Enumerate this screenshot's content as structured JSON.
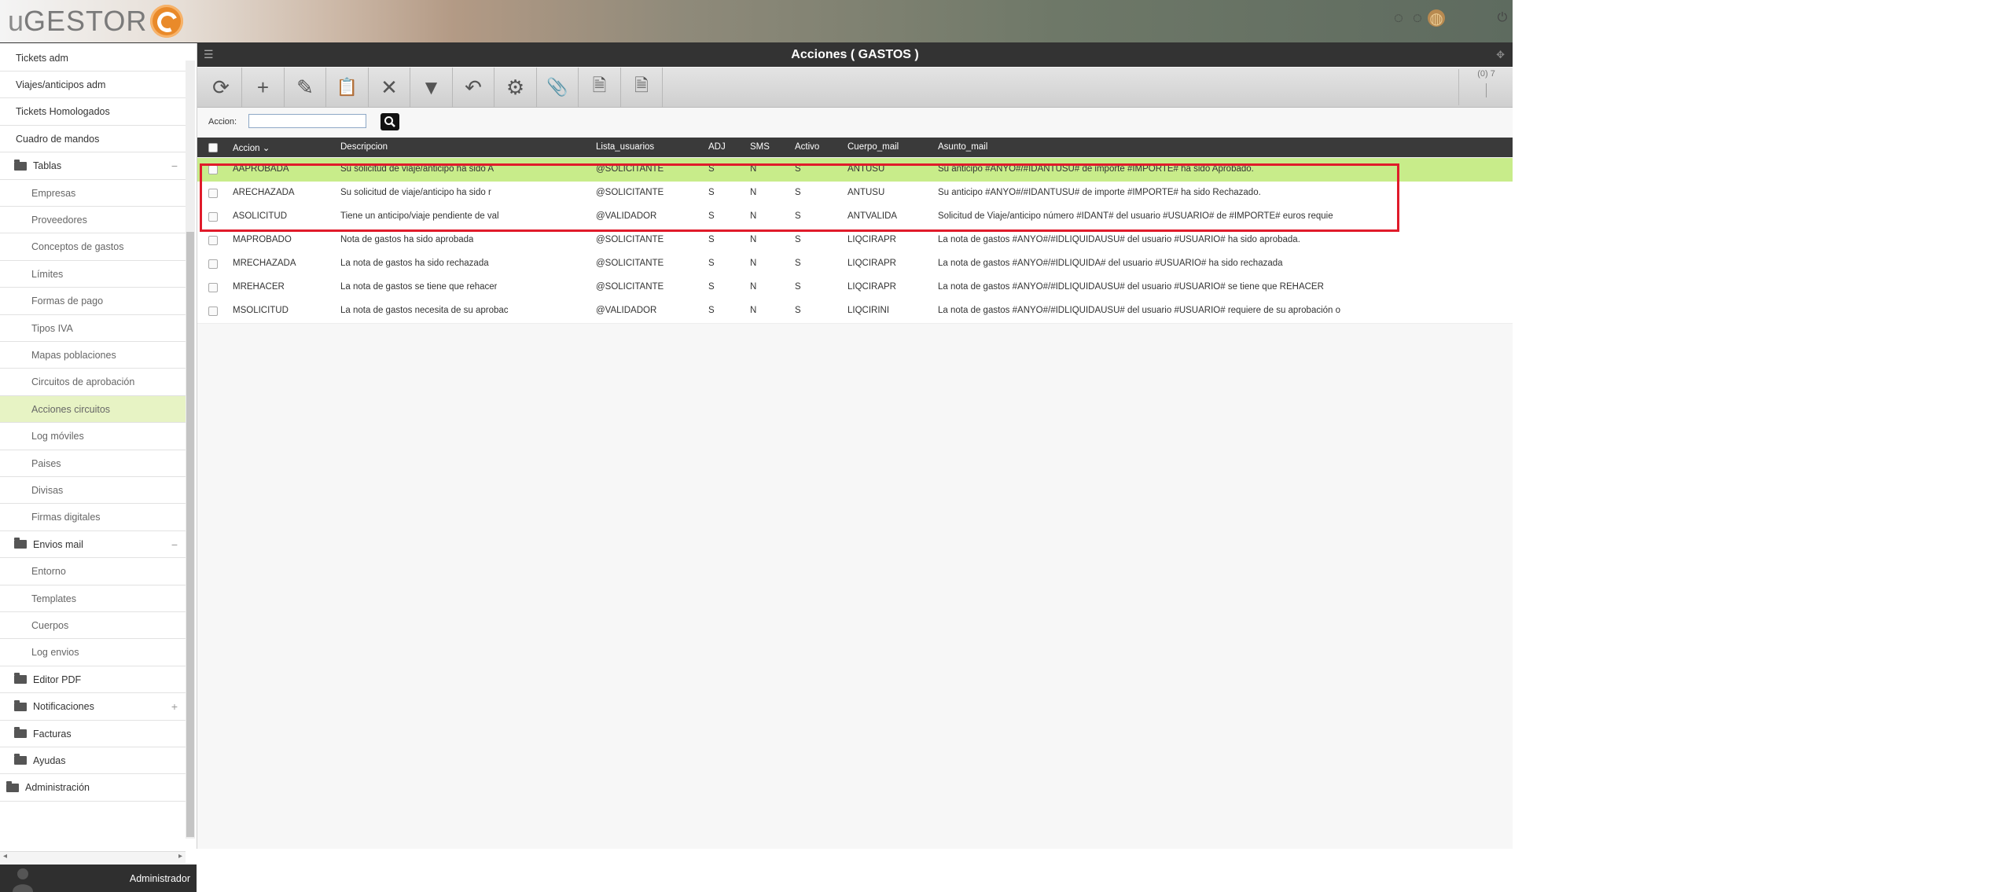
{
  "app": {
    "logo_u": "u",
    "logo_text": "GESTOR"
  },
  "user": {
    "name": "Administrador"
  },
  "sidebar": {
    "items": [
      {
        "label": "Tickets adm",
        "kind": "top"
      },
      {
        "label": "Viajes/anticipos adm",
        "kind": "top"
      },
      {
        "label": "Tickets Homologados",
        "kind": "top"
      },
      {
        "label": "Cuadro de mandos",
        "kind": "top"
      },
      {
        "label": "Tablas",
        "kind": "folder",
        "toggle": "−"
      },
      {
        "label": "Empresas",
        "kind": "sub"
      },
      {
        "label": "Proveedores",
        "kind": "sub"
      },
      {
        "label": "Conceptos de gastos",
        "kind": "sub"
      },
      {
        "label": "Límites",
        "kind": "sub"
      },
      {
        "label": "Formas de pago",
        "kind": "sub"
      },
      {
        "label": "Tipos IVA",
        "kind": "sub"
      },
      {
        "label": "Mapas poblaciones",
        "kind": "sub"
      },
      {
        "label": "Circuitos de aprobación",
        "kind": "sub"
      },
      {
        "label": "Acciones circuitos",
        "kind": "sub",
        "active": true
      },
      {
        "label": "Log móviles",
        "kind": "sub"
      },
      {
        "label": "Paises",
        "kind": "sub"
      },
      {
        "label": "Divisas",
        "kind": "sub"
      },
      {
        "label": "Firmas digitales",
        "kind": "sub"
      },
      {
        "label": "Envios mail",
        "kind": "folder",
        "toggle": "−"
      },
      {
        "label": "Entorno",
        "kind": "sub"
      },
      {
        "label": "Templates",
        "kind": "sub"
      },
      {
        "label": "Cuerpos",
        "kind": "sub"
      },
      {
        "label": "Log envios",
        "kind": "sub"
      },
      {
        "label": "Editor PDF",
        "kind": "folder"
      },
      {
        "label": "Notificaciones",
        "kind": "folder",
        "toggle": "+"
      },
      {
        "label": "Facturas",
        "kind": "folder"
      },
      {
        "label": "Ayudas",
        "kind": "folder"
      },
      {
        "label": "Administración",
        "kind": "folder-root"
      }
    ]
  },
  "main": {
    "title": "Acciones ( GASTOS )",
    "pager": "(0) 7",
    "search": {
      "label": "Accion:",
      "value": ""
    },
    "toolbar": [
      {
        "icon": "refresh-icon",
        "glyph": "⟳"
      },
      {
        "icon": "add-icon",
        "glyph": "+"
      },
      {
        "icon": "edit-icon",
        "glyph": "✎"
      },
      {
        "icon": "clipboard-icon",
        "glyph": "📋"
      },
      {
        "icon": "delete-icon",
        "glyph": "✕"
      },
      {
        "icon": "filter-icon",
        "glyph": "▼"
      },
      {
        "icon": "undo-icon",
        "glyph": "↶"
      },
      {
        "icon": "settings-icon",
        "glyph": "⚙"
      },
      {
        "icon": "attach-icon",
        "glyph": "📎"
      },
      {
        "icon": "pdf-icon",
        "glyph": "🗎"
      },
      {
        "icon": "xls-icon",
        "glyph": "🗎"
      }
    ],
    "table": {
      "columns": [
        "Accion",
        "Descripcion",
        "Lista_usuarios",
        "ADJ",
        "SMS",
        "Activo",
        "Cuerpo_mail",
        "Asunto_mail"
      ],
      "sort_indicator": "⌄",
      "rows": [
        [
          "AAPROBADA",
          "Su solicitud de viaje/anticipo ha sido A",
          "@SOLICITANTE",
          "S",
          "N",
          "S",
          "ANTUSU",
          "Su anticipo #ANYO#/#IDANTUSU# de importe #IMPORTE# ha sido Aprobado."
        ],
        [
          "ARECHAZADA",
          "Su solicitud de viaje/anticipo ha sido r",
          "@SOLICITANTE",
          "S",
          "N",
          "S",
          "ANTUSU",
          "Su anticipo #ANYO#/#IDANTUSU# de importe #IMPORTE# ha sido Rechazado."
        ],
        [
          "ASOLICITUD",
          "Tiene un anticipo/viaje pendiente de val",
          "@VALIDADOR",
          "S",
          "N",
          "S",
          "ANTVALIDA",
          "Solicitud de Viaje/anticipo número #IDANT# del usuario #USUARIO# de #IMPORTE# euros requie"
        ],
        [
          "MAPROBADO",
          "Nota de gastos ha sido aprobada",
          "@SOLICITANTE",
          "S",
          "N",
          "S",
          "LIQCIRAPR",
          "La nota de gastos #ANYO#/#IDLIQUIDAUSU# del usuario #USUARIO# ha sido aprobada."
        ],
        [
          "MRECHAZADA",
          "La nota de gastos ha sido rechazada",
          "@SOLICITANTE",
          "S",
          "N",
          "S",
          "LIQCIRAPR",
          "La nota de gastos #ANYO#/#IDLIQUIDA# del usuario #USUARIO# ha sido rechazada"
        ],
        [
          "MREHACER",
          "La nota de gastos se tiene que rehacer",
          "@SOLICITANTE",
          "S",
          "N",
          "S",
          "LIQCIRAPR",
          "La nota de gastos #ANYO#/#IDLIQUIDAUSU# del usuario #USUARIO# se tiene que REHACER"
        ],
        [
          "MSOLICITUD",
          "La nota de gastos necesita de su aprobac",
          "@VALIDADOR",
          "S",
          "N",
          "S",
          "LIQCIRINI",
          "La nota de gastos #ANYO#/#IDLIQUIDAUSU# del usuario #USUARIO# requiere de su aprobación o"
        ]
      ],
      "selected_row": 0
    }
  },
  "colors": {
    "selected_row": "#c8ec8a",
    "highlight_box": "#e01b2a",
    "header_bg": "#333333"
  }
}
